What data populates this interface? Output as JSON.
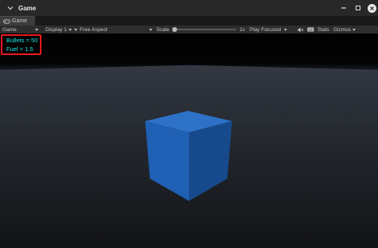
{
  "window": {
    "title": "Game"
  },
  "tabs": [
    {
      "label": "Game",
      "icon": "gamepad-icon"
    }
  ],
  "toolbar": {
    "mode": "Game",
    "display": "Display 1",
    "aspect": "Free Aspect",
    "scale_label": "Scale",
    "scale_value": "1x",
    "play_mode": "Play Focused",
    "stats": "Stats",
    "gizmos": "Gizmos"
  },
  "hud": {
    "bullets": "Bullets = 50",
    "fuel": "Fuel = 1.5"
  },
  "colors": {
    "cube_top": "#2d72c7",
    "cube_front": "#1f5fb4",
    "cube_side": "#164a8c",
    "hud_text": "#19e8e6",
    "hud_border": "#e8191e"
  }
}
